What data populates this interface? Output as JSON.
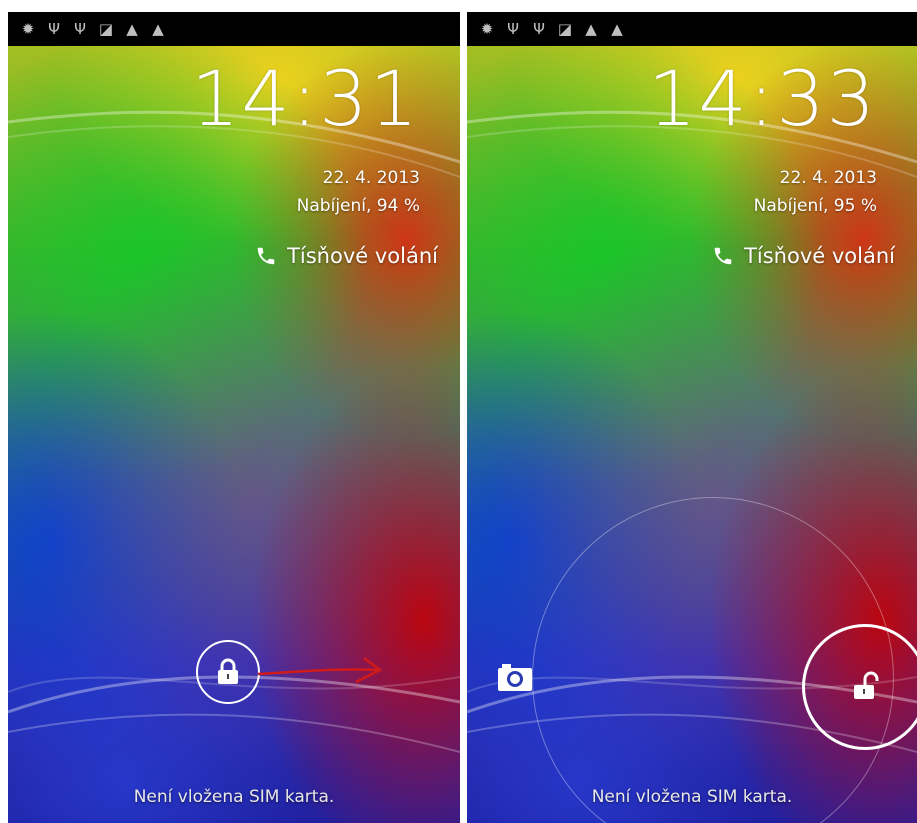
{
  "left_screen": {
    "status_icons": [
      "android-debug-icon",
      "usb-icon",
      "usb-icon",
      "no-sim-icon",
      "warning-icon",
      "warning-icon"
    ],
    "time": "14:31",
    "date": "22. 4. 2013",
    "charging": "Nabíjení, 94 %",
    "emergency_label": "Tísňové volání",
    "sim_status": "Není vložena SIM karta.",
    "colors": {
      "arrow": "#d11a1a",
      "battery": "#33b5e5"
    }
  },
  "right_screen": {
    "status_icons": [
      "android-debug-icon",
      "usb-icon",
      "usb-icon",
      "no-sim-icon",
      "warning-icon",
      "warning-icon"
    ],
    "time": "14:33",
    "date": "22. 4. 2013",
    "charging": "Nabíjení, 95 %",
    "emergency_label": "Tísňové volání",
    "sim_status": "Není vložena SIM karta.",
    "colors": {
      "battery": "#33b5e5"
    }
  }
}
